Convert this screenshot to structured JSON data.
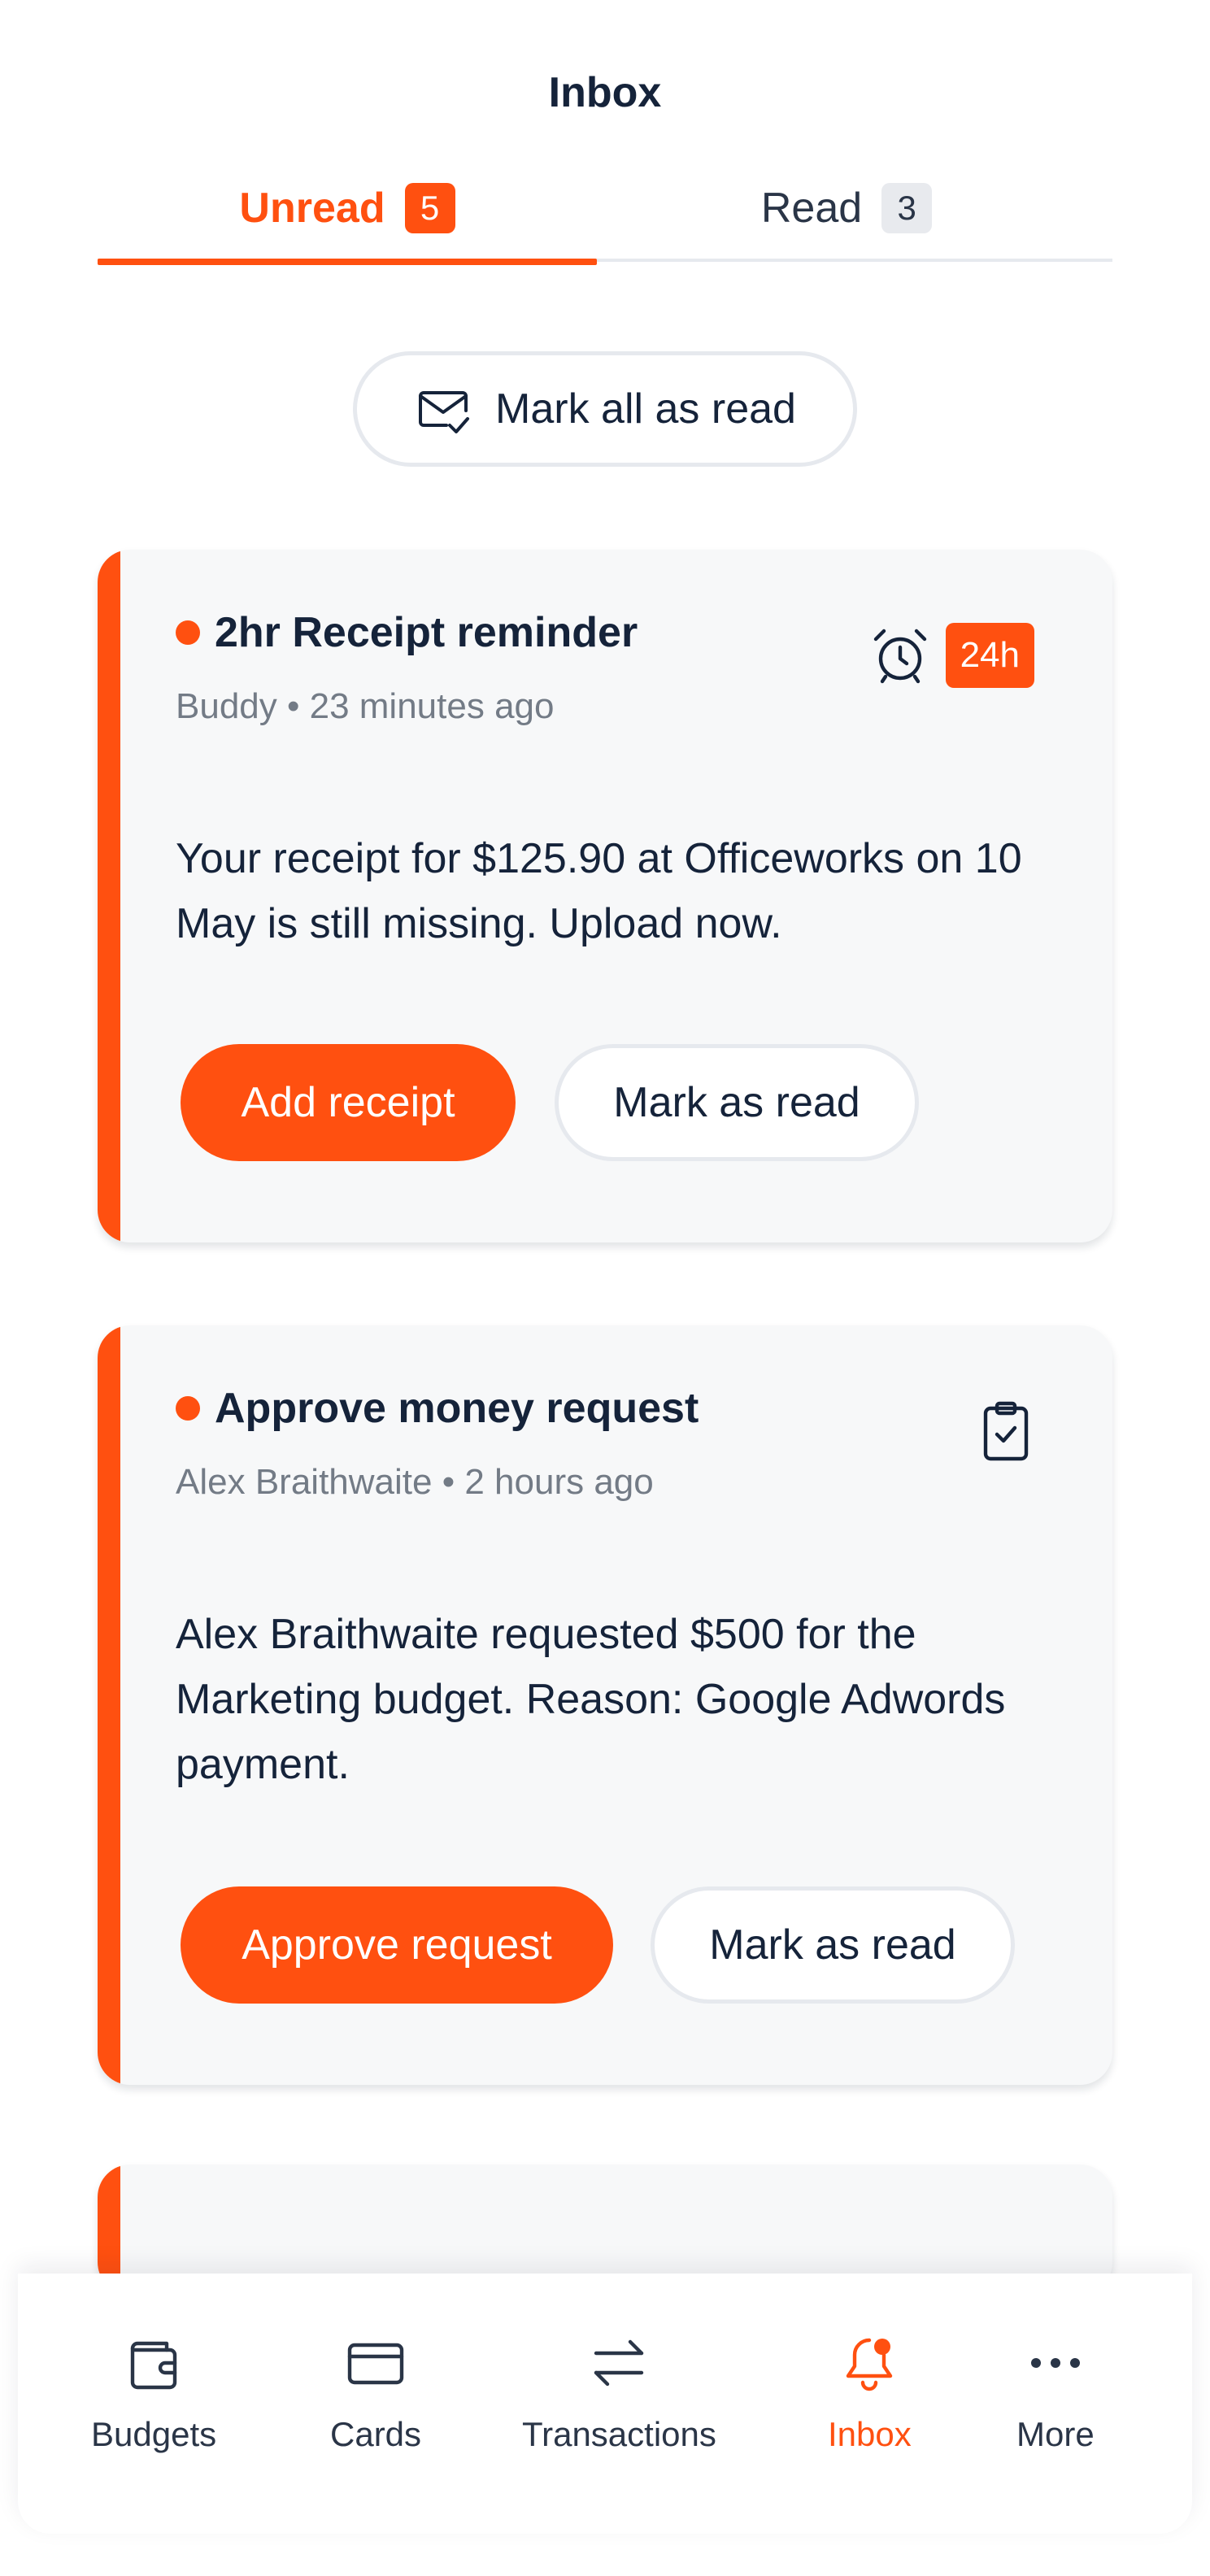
{
  "header": {
    "title": "Inbox"
  },
  "tabs": [
    {
      "label": "Unread",
      "count": "5"
    },
    {
      "label": "Read",
      "count": "3"
    }
  ],
  "mark_all": {
    "label": "Mark all as read",
    "icon": "envelope-check-icon"
  },
  "notifications": [
    {
      "title": "2hr Receipt reminder",
      "meta": "Buddy • 23 minutes ago",
      "body": "Your receipt for $125.90 at Officeworks on 10 May is still missing. Upload now.",
      "badge": "24h",
      "icon": "alarm-clock-icon",
      "primary_action": "Add receipt",
      "secondary_action": "Mark as read"
    },
    {
      "title": "Approve money request",
      "meta": "Alex Braithwaite • 2 hours ago",
      "body": "Alex Braithwaite requested $500 for the Marketing budget. Reason: Google Adwords payment.",
      "icon": "clipboard-check-icon",
      "primary_action": "Approve request",
      "secondary_action": "Mark as read"
    }
  ],
  "bottom_nav": [
    {
      "label": "Budgets",
      "icon": "wallet-icon"
    },
    {
      "label": "Cards",
      "icon": "card-icon"
    },
    {
      "label": "Transactions",
      "icon": "transfer-arrows-icon"
    },
    {
      "label": "Inbox",
      "icon": "bell-icon",
      "active": true
    },
    {
      "label": "More",
      "icon": "more-dots-icon"
    }
  ],
  "colors": {
    "accent": "#ff5010",
    "text": "#15233a",
    "muted": "#737b86",
    "card_bg": "#f7f8f9"
  }
}
